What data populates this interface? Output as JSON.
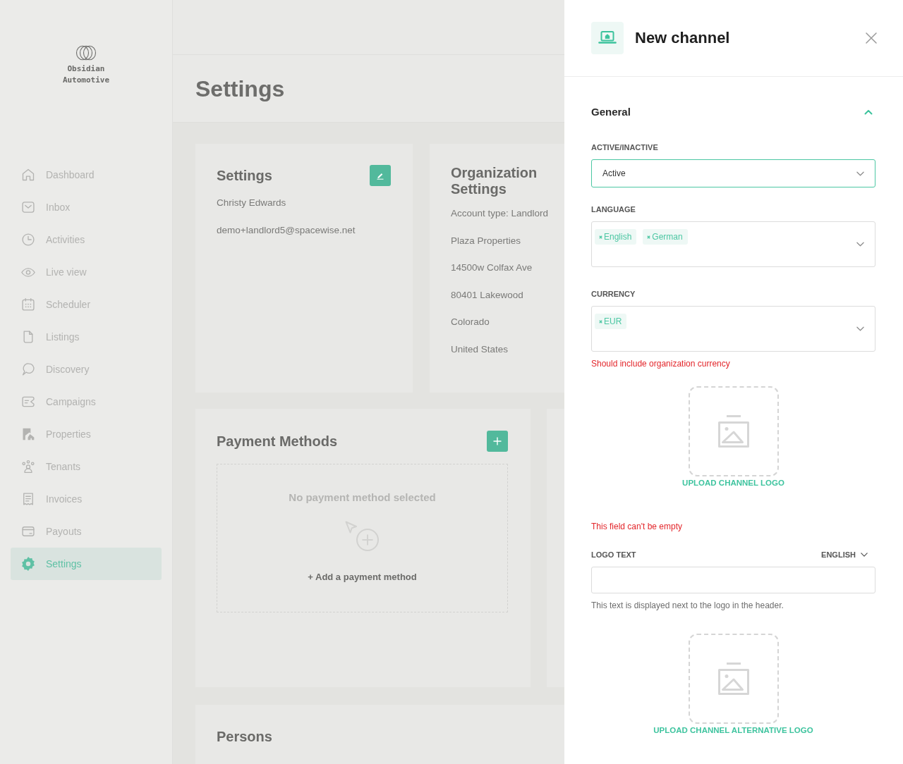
{
  "sidebar": {
    "brand": "Obsidian Automotive",
    "items": [
      {
        "label": "Dashboard",
        "selected": false
      },
      {
        "label": "Inbox",
        "selected": false
      },
      {
        "label": "Activities",
        "selected": false
      },
      {
        "label": "Live view",
        "selected": false
      },
      {
        "label": "Scheduler",
        "selected": false
      },
      {
        "label": "Listings",
        "selected": false
      },
      {
        "label": "Discovery",
        "selected": false
      },
      {
        "label": "Campaigns",
        "selected": false
      },
      {
        "label": "Properties",
        "selected": false
      },
      {
        "label": "Tenants",
        "selected": false
      },
      {
        "label": "Invoices",
        "selected": false
      },
      {
        "label": "Payouts",
        "selected": false
      },
      {
        "label": "Settings",
        "selected": true
      }
    ]
  },
  "page": {
    "title": "Settings"
  },
  "profile_card": {
    "title": "Settings",
    "lines": [
      "Christy Edwards",
      "demo+landlord5@spacewise.net"
    ]
  },
  "organization_card": {
    "title": "Organization Settings",
    "lines": [
      "Account type: Landlord",
      "Plaza Properties",
      "14500w Colfax Ave",
      "80401 Lakewood",
      "Colorado",
      "United States"
    ]
  },
  "payment_methods_card": {
    "title": "Payment Methods",
    "empty_text": "No payment method selected",
    "add_link": "+ Add a payment method"
  },
  "persons_card": {
    "title": "Persons"
  },
  "drawer": {
    "title": "New channel",
    "section": {
      "title": "General",
      "expanded": true
    },
    "fields": [
      {
        "kind": "select",
        "label": "ACTIVE/INACTIVE",
        "value": "Active",
        "focused": true
      },
      {
        "kind": "multiselect",
        "label": "LANGUAGE",
        "chips": [
          "English",
          "German"
        ]
      },
      {
        "kind": "multiselect",
        "label": "CURRENCY",
        "chips": [
          "EUR"
        ],
        "error": "Should include organization currency"
      },
      {
        "kind": "upload",
        "button": "UPLOAD CHANNEL LOGO",
        "error": "This field can't be empty"
      },
      {
        "kind": "text",
        "label": "LOGO TEXT",
        "language": "ENGLISH",
        "hint": "This text is displayed next to the logo in the header."
      },
      {
        "kind": "upload",
        "button": "UPLOAD CHANNEL ALTERNATIVE LOGO"
      }
    ]
  }
}
